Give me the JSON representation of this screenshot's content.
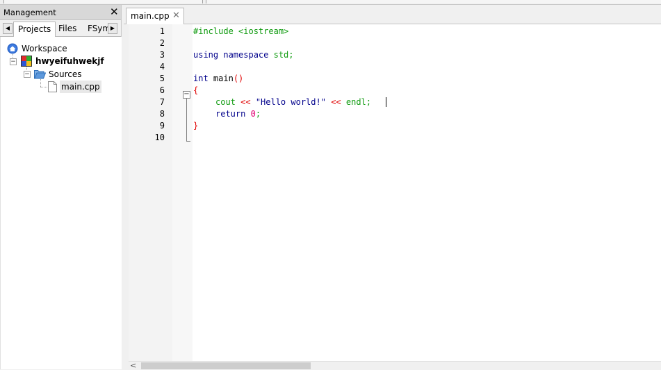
{
  "management": {
    "title": "Management",
    "close_glyph": "✕",
    "tabs": [
      "Projects",
      "Files",
      "FSym"
    ],
    "active_tab": "Projects",
    "scroll_left": "◀",
    "scroll_right": "▶"
  },
  "tree": {
    "workspace": "Workspace",
    "project": "hwyeifuhwekjf",
    "sources": "Sources",
    "file": "main.cpp"
  },
  "editor": {
    "tab_label": "main.cpp",
    "tab_close": "✕",
    "fold_minus": "−",
    "scroll_left": "<",
    "line_numbers": [
      "1",
      "2",
      "3",
      "4",
      "5",
      "6",
      "7",
      "8",
      "9",
      "10"
    ]
  },
  "code": {
    "l1": "#include <iostream>",
    "l3_kw": "using namespace",
    "l3_rest": " std;",
    "l5_kw": "int",
    "l5_rest": " main",
    "l5_paren": "()",
    "l6": "{",
    "l7_cout": "cout",
    "l7_op1": " << ",
    "l7_str": "\"Hello world!\"",
    "l7_op2": " << ",
    "l7_endl": "endl;",
    "l8_kw": "return",
    "l8_num": " 0",
    "l8_end": ";",
    "l9": "}"
  },
  "colors": {
    "keyword": "#00008b",
    "preprocessor": "#109b10",
    "operator": "#e00000",
    "number": "#e00070"
  }
}
